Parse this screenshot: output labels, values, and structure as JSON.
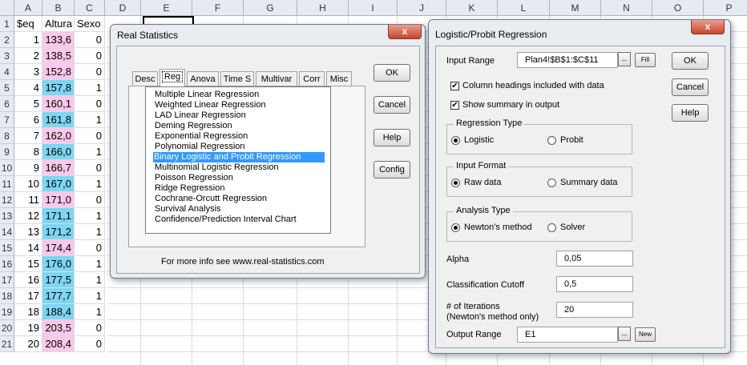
{
  "sheet": {
    "columns": [
      "A",
      "B",
      "C",
      "D",
      "E",
      "F",
      "G",
      "H",
      "I",
      "J",
      "K",
      "L",
      "M",
      "N",
      "O",
      "P"
    ],
    "rows": [
      "1",
      "2",
      "3",
      "4",
      "5",
      "6",
      "7",
      "8",
      "9",
      "10",
      "11",
      "12",
      "13",
      "14",
      "15",
      "16",
      "17",
      "18",
      "19",
      "20",
      "21"
    ],
    "headers": [
      "$eq",
      "Altura",
      "Sexo"
    ],
    "data": [
      [
        "1",
        "133,6",
        "0"
      ],
      [
        "2",
        "138,5",
        "0"
      ],
      [
        "3",
        "152,8",
        "0"
      ],
      [
        "4",
        "157,8",
        "1"
      ],
      [
        "5",
        "160,1",
        "0"
      ],
      [
        "6",
        "161,8",
        "1"
      ],
      [
        "7",
        "162,0",
        "0"
      ],
      [
        "8",
        "166,0",
        "1"
      ],
      [
        "9",
        "166,7",
        "0"
      ],
      [
        "10",
        "167,0",
        "1"
      ],
      [
        "11",
        "171,0",
        "0"
      ],
      [
        "12",
        "171,1",
        "1"
      ],
      [
        "13",
        "171,2",
        "1"
      ],
      [
        "14",
        "174,4",
        "0"
      ],
      [
        "15",
        "176,0",
        "1"
      ],
      [
        "16",
        "177,5",
        "1"
      ],
      [
        "17",
        "177,7",
        "1"
      ],
      [
        "18",
        "188,4",
        "1"
      ],
      [
        "19",
        "203,5",
        "0"
      ],
      [
        "20",
        "208,4",
        "0"
      ]
    ],
    "colors": {
      "pink": "#f9c8ea",
      "blue": "#7dd6f2"
    },
    "b_colors": [
      "pink",
      "pink",
      "pink",
      "blue",
      "pink",
      "blue",
      "pink",
      "blue",
      "pink",
      "blue",
      "pink",
      "blue",
      "blue",
      "pink",
      "blue",
      "blue",
      "blue",
      "blue",
      "pink",
      "pink"
    ]
  },
  "rs_dialog": {
    "title": "Real Statistics",
    "close": "x",
    "tabs": [
      "Desc",
      "Reg",
      "Anova",
      "Time S",
      "Multivar",
      "Corr",
      "Misc"
    ],
    "items": [
      "Multiple Linear Regression",
      "Weighted Linear Regression",
      "LAD Linear Regression",
      "Deming Regression",
      "Exponential Regression",
      "Polynomial Regression",
      "Binary Logistic and Probit Regression",
      "Multinomial Logistic Regression",
      "Poisson Regression",
      "Ridge Regression",
      "Cochrane-Orcutt Regression",
      "Survival Analysis",
      "Confidence/Prediction Interval Chart"
    ],
    "buttons": {
      "ok": "OK",
      "cancel": "Cancel",
      "help": "Help",
      "config": "Config"
    },
    "footer": "For more info see www.real-statistics.com"
  },
  "lp_dialog": {
    "title": "Logistic/Probit Regression",
    "close": "x",
    "input_range_label": "Input Range",
    "input_range_value": "Plan4!$B$1:$C$11",
    "collapse": "_",
    "fill": "Fill",
    "col_headings": "Column headings included with data",
    "show_summary": "Show summary in output",
    "regression_type": {
      "title": "Regression Type",
      "logistic": "Logistic",
      "probit": "Probit"
    },
    "input_format": {
      "title": "Input Format",
      "raw": "Raw data",
      "summary": "Summary data"
    },
    "analysis_type": {
      "title": "Analysis Type",
      "newton": "Newton's method",
      "solver": "Solver"
    },
    "alpha_label": "Alpha",
    "alpha_value": "0,05",
    "cutoff_label": "Classification Cutoff",
    "cutoff_value": "0,5",
    "iter_label_1": "# of Iterations",
    "iter_label_2": "(Newton's method only)",
    "iter_value": "20",
    "output_label": "Output Range",
    "output_value": "E1",
    "new": "New",
    "buttons": {
      "ok": "OK",
      "cancel": "Cancel",
      "help": "Help"
    }
  }
}
